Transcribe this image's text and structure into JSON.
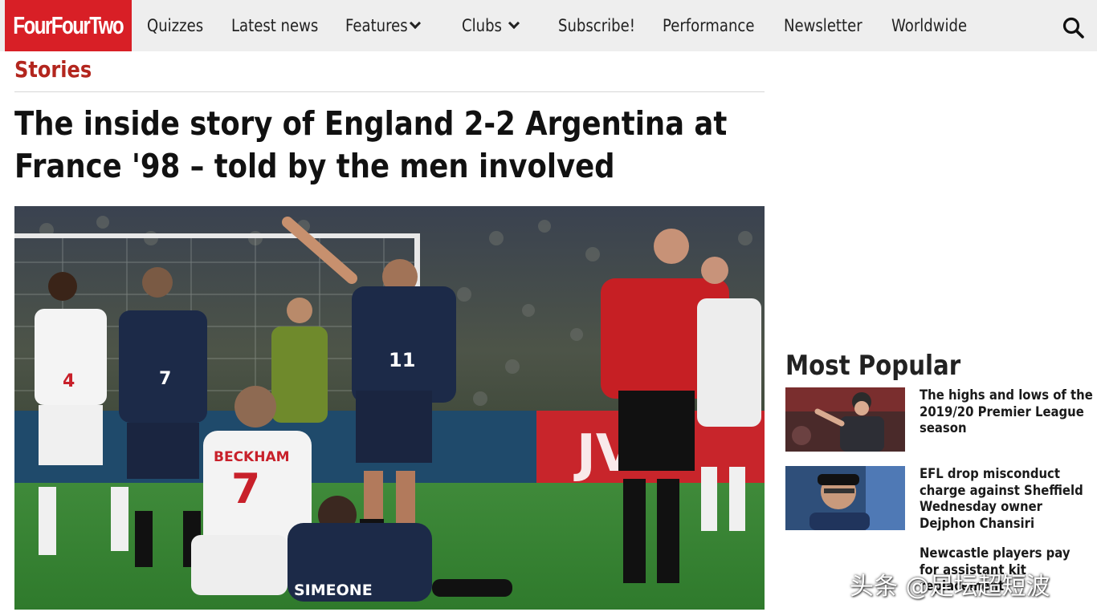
{
  "brand": {
    "logo_text": "FourFourTwo",
    "accent": "#d81f26"
  },
  "nav": {
    "items": [
      {
        "label": "Quizzes"
      },
      {
        "label": "Latest news"
      },
      {
        "label": "Features"
      },
      {
        "label": "Clubs"
      },
      {
        "label": "Subscribe!"
      },
      {
        "label": "Performance"
      },
      {
        "label": "Newsletter"
      },
      {
        "label": "Worldwide"
      }
    ],
    "search_icon": "search-icon",
    "dropdown_icon": "chevron-down-icon"
  },
  "article": {
    "section": "Stories",
    "title": "The inside story of England 2-2 Argentina at France '98 – told by the men involved",
    "hero_shirts": {
      "player_7_name": "BECKHAM",
      "player_7_number": "7",
      "player_11_number": "11",
      "simeone_name": "SIMEONE",
      "player_4_number": "4",
      "ad_board": "JV"
    }
  },
  "sidebar": {
    "title": "Most Popular",
    "items": [
      {
        "headline": "The highs and lows of the 2019/20 Premier League season"
      },
      {
        "headline": "EFL drop misconduct charge against Sheffield Wednesday owner Dejphon Chansiri"
      },
      {
        "headline": "Newcastle players pay for assistant kit replacement"
      }
    ]
  },
  "watermark": "头条 @足坛超短波"
}
